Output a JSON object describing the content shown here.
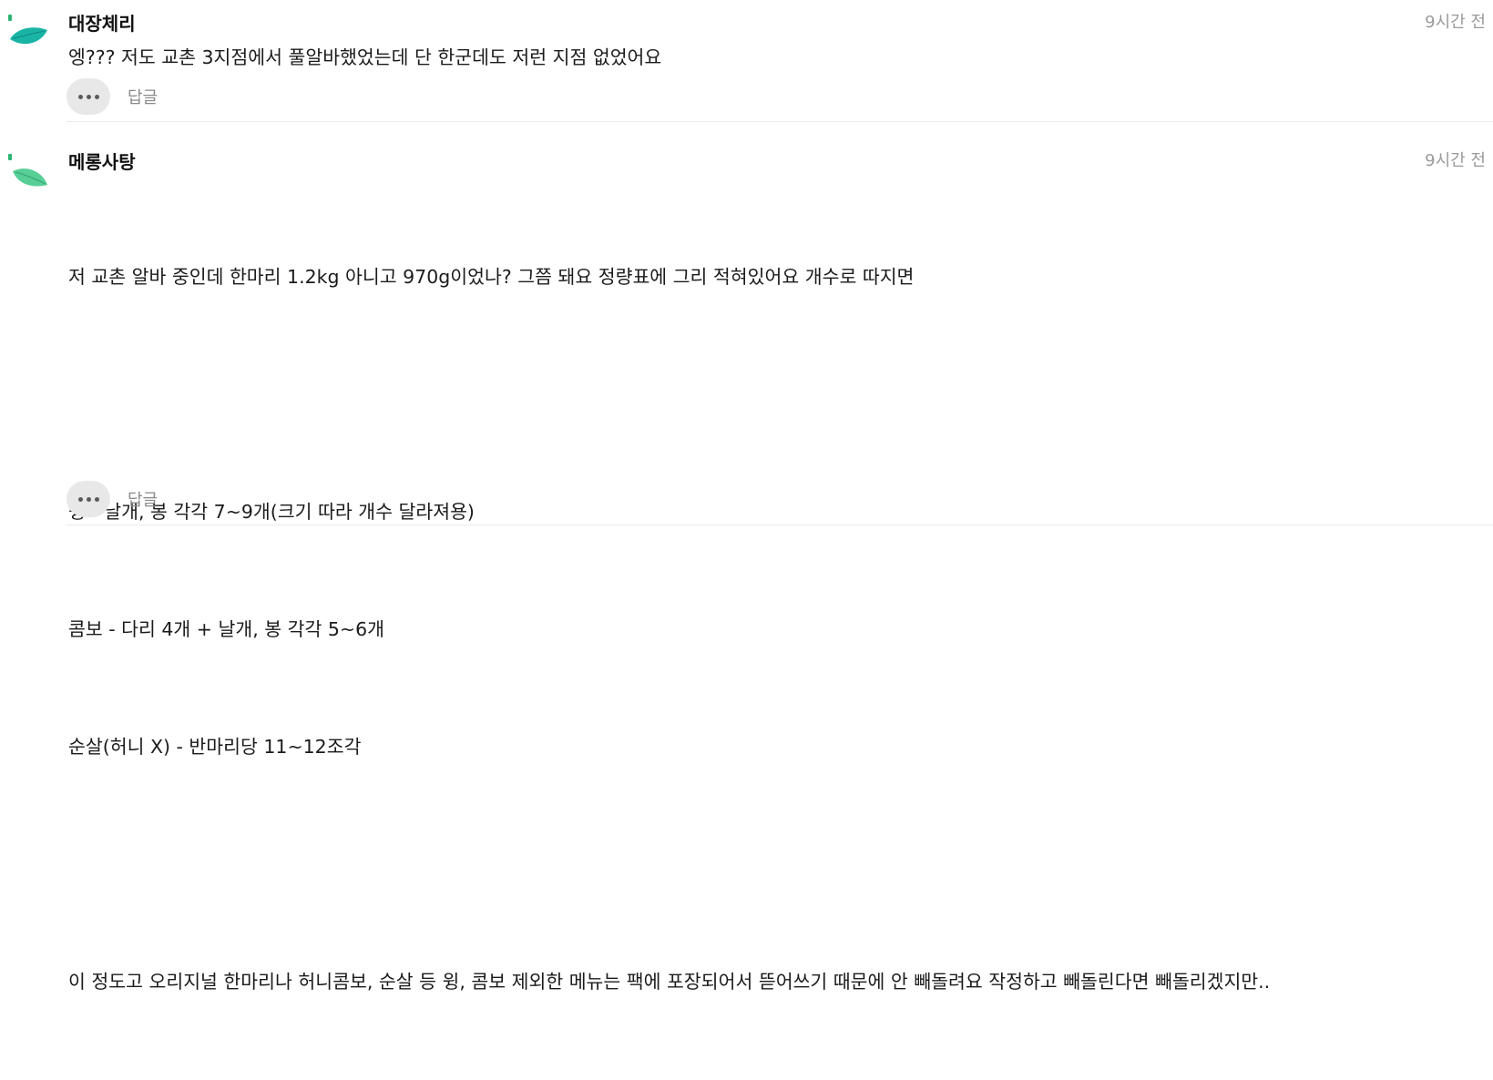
{
  "comments": [
    {
      "nickname": "대장체리",
      "time": "9시간 전",
      "text": "엥??? 저도 교촌 3지점에서 풀알바했었는데 단 한군데도 저런 지점 없었어요",
      "more_icon": "more-horizontal-icon",
      "reply_label": "답글",
      "avatar_color": "#1cb8a8",
      "avatar_badge": "B"
    },
    {
      "nickname": "메롱사탕",
      "time": "9시간 전",
      "text_lines": [
        "저 교촌 알바 중인데 한마리 1.2kg 아니고 970g이었나? 그쯤 돼요 정량표에 그리 적혀있어요 개수로 따지면",
        "",
        "윙 - 날개, 봉 각각 7~9개(크기 따라 개수 달라져용)",
        "콤보 - 다리 4개 + 날개, 봉 각각 5~6개",
        "순살(허니 X) - 반마리당 11~12조각",
        "",
        "이 정도고 오리지널 한마리나 허니콤보, 순살 등 윙, 콤보 제외한 메뉴는 팩에 포장되어서 뜯어쓰기 때문에 안 빼돌려요 작정하고 빼돌린다면 빼돌리겠지만.."
      ],
      "more_icon": "more-horizontal-icon",
      "reply_label": "답글",
      "avatar_color": "#5ed19a",
      "avatar_badge": "B"
    }
  ]
}
